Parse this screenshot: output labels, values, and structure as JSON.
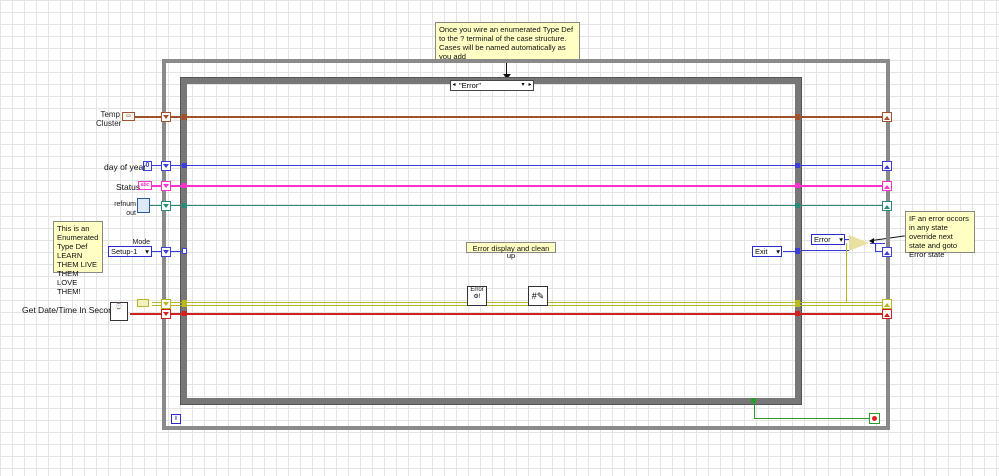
{
  "notes": {
    "top": "Once you wire an enumerated Type Def to the ? terminal of the case structure. Cases will be named automatically as you add",
    "left": "This is an Enumerated Type Def LEARN THEM LIVE THEM LOVE THEM!",
    "right": "IF an error occors in any state override next state and goto Error state"
  },
  "controls": {
    "temp_cluster": "Temp Cluster",
    "day_of_year": "day of year",
    "day_of_year_value": "0",
    "status": "Status",
    "refnum_out": "refnum out",
    "mode_label": "Mode",
    "mode_value": "Setup-1",
    "get_datetime": "Get Date/Time In Seconds"
  },
  "case_structure": {
    "selector_value": "\"Error\"",
    "description": "Error display and clean up"
  },
  "inner": {
    "exit_enum": "Exit",
    "error_enum": "Error",
    "loop_index": "i"
  },
  "colors": {
    "cluster_wire": "#a0522d",
    "int_wire": "#3c3cd8",
    "string_wire": "#ff33cc",
    "refnum_wire": "#2a8a7a",
    "error_wire": "#b8b820",
    "time_wire": "#d02020",
    "bool_wire": "#2a9a2a"
  }
}
